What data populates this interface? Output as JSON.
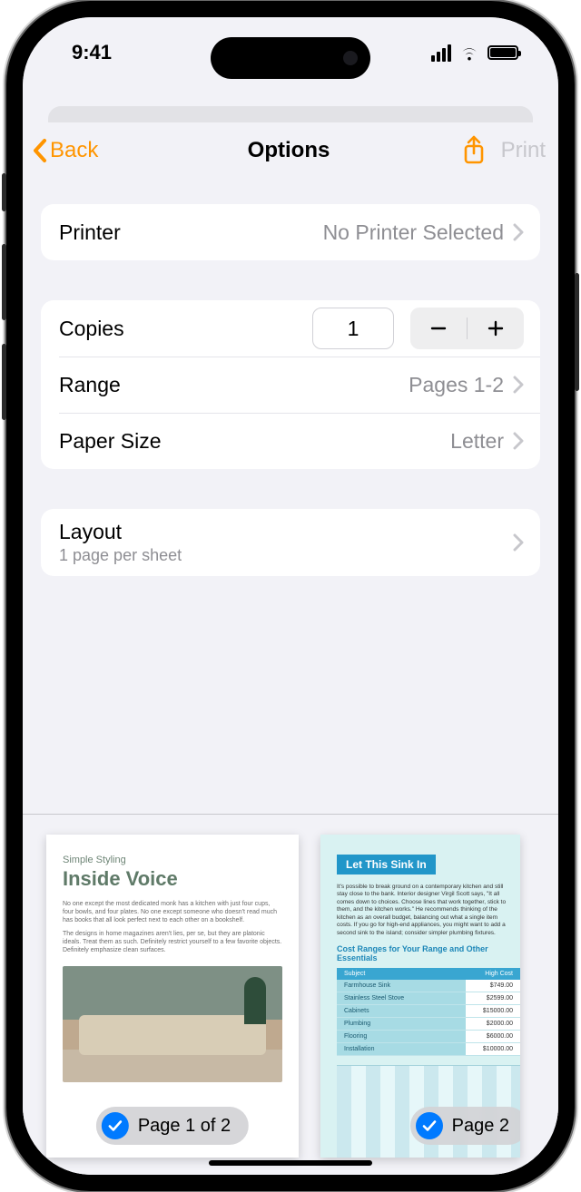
{
  "status": {
    "time": "9:41"
  },
  "nav": {
    "back_label": "Back",
    "title": "Options",
    "print_label": "Print"
  },
  "printer": {
    "label": "Printer",
    "value": "No Printer Selected"
  },
  "copies": {
    "label": "Copies",
    "value": "1"
  },
  "range": {
    "label": "Range",
    "value": "Pages 1-2"
  },
  "paper_size": {
    "label": "Paper Size",
    "value": "Letter"
  },
  "layout": {
    "label": "Layout",
    "sub": "1 page per sheet"
  },
  "preview": {
    "page1_badge": "Page 1 of 2",
    "page2_badge": "Page 2",
    "page1": {
      "subtitle": "Simple Styling",
      "title": "Inside Voice",
      "para1": "No one except the most dedicated monk has a kitchen with just four cups, four bowls, and four plates. No one except someone who doesn't read much has books that all look perfect next to each other on a bookshelf.",
      "para2": "The designs in home magazines aren't lies, per se, but they are platonic ideals. Treat them as such. Definitely restrict yourself to a few favorite objects. Definitely emphasize clean surfaces."
    },
    "page2": {
      "heading": "Let This Sink In",
      "intro": "It's possible to break ground on a contemporary kitchen and still stay close to the bank. Interior designer Virgil Scott says, \"It all comes down to choices. Choose lines that work together, stick to them, and the kitchen works.\" He recommends thinking of the kitchen as an overall budget, balancing out what a single item costs. If you go for high-end appliances, you might want to add a second sink to the island; consider simpler plumbing fixtures.",
      "section_title": "Cost Ranges for Your Range and Other Essentials",
      "table_header_subject": "Subject",
      "table_header_cost": "High Cost",
      "rows": [
        {
          "label": "Farmhouse Sink",
          "cost": "$749.00"
        },
        {
          "label": "Stainless Steel Stove",
          "cost": "$2599.00"
        },
        {
          "label": "Cabinets",
          "cost": "$15000.00"
        },
        {
          "label": "Plumbing",
          "cost": "$2000.00"
        },
        {
          "label": "Flooring",
          "cost": "$6000.00"
        },
        {
          "label": "Installation",
          "cost": "$10000.00"
        }
      ]
    }
  }
}
